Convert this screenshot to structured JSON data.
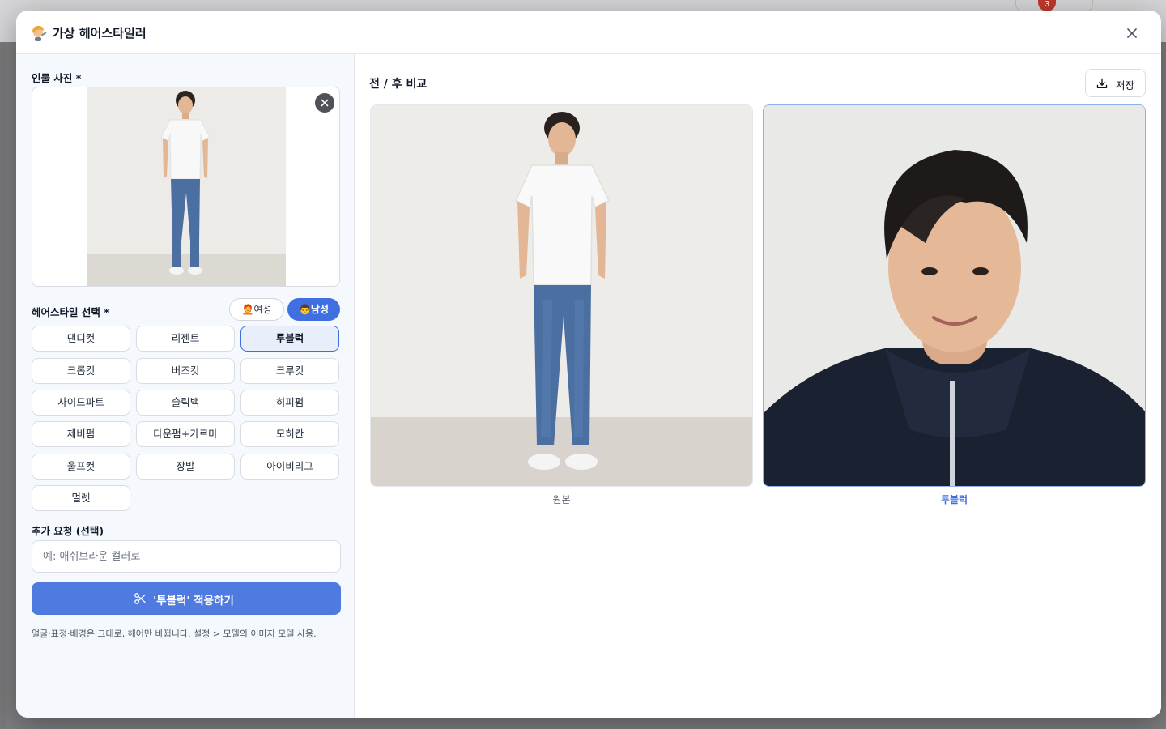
{
  "background": {
    "notification_count": "3"
  },
  "modal": {
    "title_icon": "hairdresser-icon",
    "title": "가상 헤어스타일러",
    "close_icon": "close-icon"
  },
  "left": {
    "photo_label": "인물 사진 *",
    "hairstyle_label": "헤어스타일 선택 *",
    "gender": {
      "female_icon": "🧑‍🦰",
      "female": "여성",
      "male_icon": "👨",
      "male": "남성",
      "selected": "남성"
    },
    "styles": [
      "댄디컷",
      "리젠트",
      "투블럭",
      "크롭컷",
      "버즈컷",
      "크루컷",
      "사이드파트",
      "슬릭백",
      "히피펌",
      "제비펌",
      "다운펌+가르마",
      "모히칸",
      "울프컷",
      "장발",
      "아이비리그",
      "멀렛"
    ],
    "selected_style": "투블럭",
    "extra_label": "추가 요청 (선택)",
    "extra_placeholder": "예: 애쉬브라운 컬러로",
    "extra_value": "",
    "apply_button": "'투블럭' 적용하기",
    "hint": "얼굴·표정·배경은 그대로, 헤어만 바뀝니다. 설정 > 모델의 이미지 모델 사용."
  },
  "right": {
    "title": "전 / 후 비교",
    "save_button": "저장",
    "before_caption": "원본",
    "after_caption": "투블럭"
  },
  "colors": {
    "accent": "#3f6fe0",
    "apply_button": "#4f7be0",
    "panel_bg": "#f5f8fc"
  }
}
